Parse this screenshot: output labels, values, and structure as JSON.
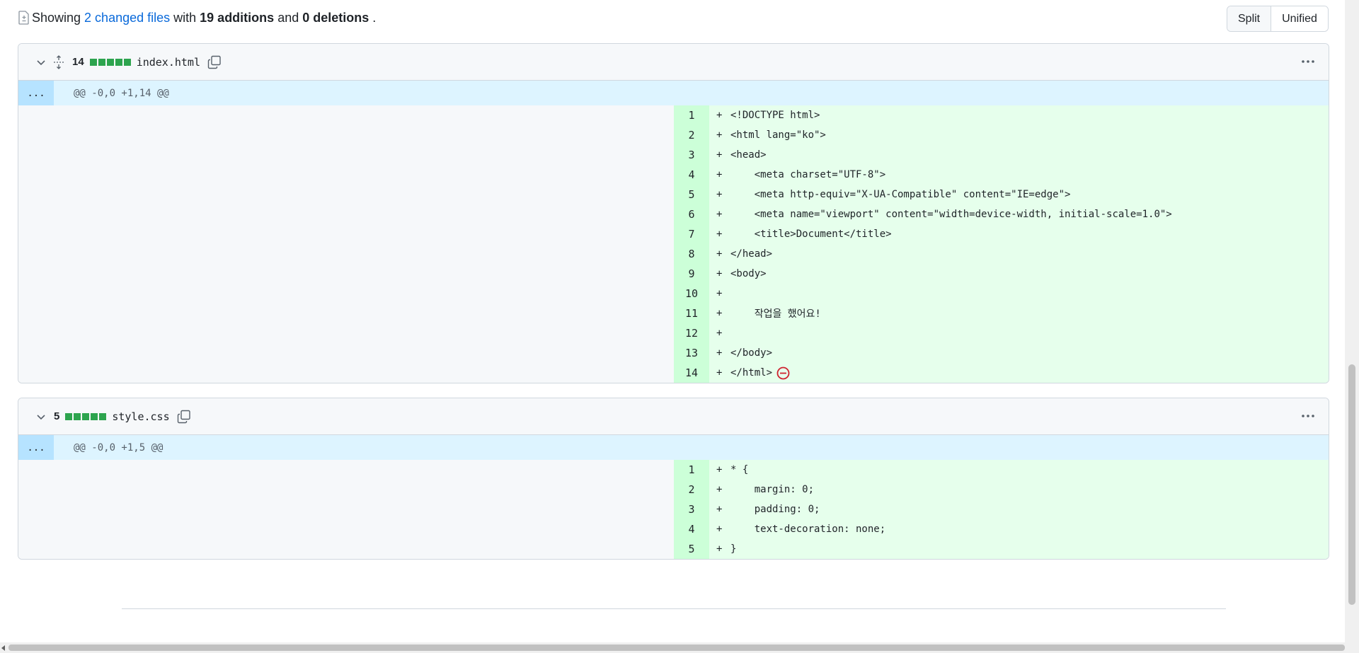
{
  "summary": {
    "prefix": "Showing",
    "changed_files": "2 changed files",
    "with": "with",
    "additions": "19 additions",
    "and": "and",
    "deletions": "0 deletions",
    "period": "."
  },
  "view_toggle": {
    "split": "Split",
    "unified": "Unified"
  },
  "files": [
    {
      "count": "14",
      "name": "index.html",
      "expander": "...",
      "hunk": "@@ -0,0 +1,14 @@",
      "lines": [
        {
          "n": "1",
          "text": "<!DOCTYPE html>"
        },
        {
          "n": "2",
          "text": "<html lang=\"ko\">"
        },
        {
          "n": "3",
          "text": "<head>"
        },
        {
          "n": "4",
          "text": "    <meta charset=\"UTF-8\">"
        },
        {
          "n": "5",
          "text": "    <meta http-equiv=\"X-UA-Compatible\" content=\"IE=edge\">"
        },
        {
          "n": "6",
          "text": "    <meta name=\"viewport\" content=\"width=device-width, initial-scale=1.0\">"
        },
        {
          "n": "7",
          "text": "    <title>Document</title>"
        },
        {
          "n": "8",
          "text": "</head>"
        },
        {
          "n": "9",
          "text": "<body>"
        },
        {
          "n": "10",
          "text": ""
        },
        {
          "n": "11",
          "text": "    작업을 했어요!"
        },
        {
          "n": "12",
          "text": ""
        },
        {
          "n": "13",
          "text": "</body>"
        },
        {
          "n": "14",
          "text": "</html>"
        }
      ]
    },
    {
      "count": "5",
      "name": "style.css",
      "expander": "...",
      "hunk": "@@ -0,0 +1,5 @@",
      "lines": [
        {
          "n": "1",
          "text": "* {"
        },
        {
          "n": "2",
          "text": "    margin: 0;"
        },
        {
          "n": "3",
          "text": "    padding: 0;"
        },
        {
          "n": "4",
          "text": "    text-decoration: none;"
        },
        {
          "n": "5",
          "text": "}"
        }
      ]
    }
  ],
  "plus_sign": "+",
  "colors": {
    "addition_bg": "#e6ffec",
    "addition_num_bg": "#ccffd8",
    "hunk_bg": "#ddf4ff",
    "link": "#0969da",
    "bar_green": "#2da44e",
    "no_eol": "#cf222e"
  },
  "icons": [
    "file-diff-icon",
    "chevron-down-icon",
    "unfold-icon",
    "copy-icon",
    "kebab-horizontal-icon",
    "no-newline-icon"
  ]
}
